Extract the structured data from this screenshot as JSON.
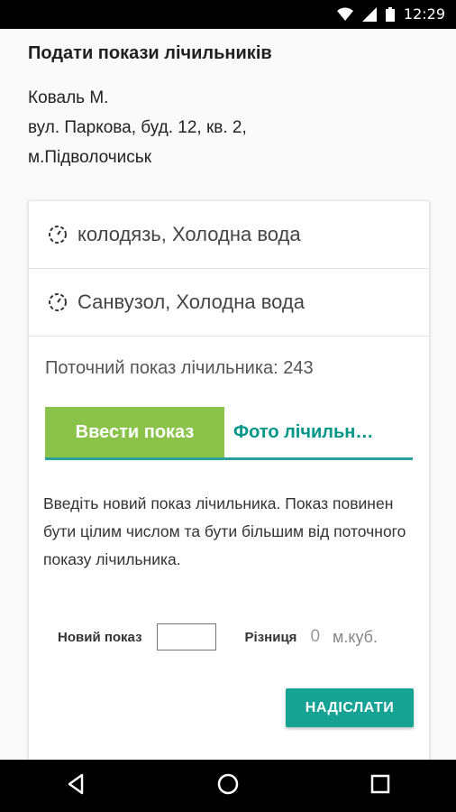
{
  "status_bar": {
    "time": "12:29",
    "icons": [
      "wifi-icon",
      "signal-icon",
      "battery-icon"
    ]
  },
  "header": {
    "title": "Подати покази лічильників"
  },
  "account": {
    "name": "Коваль М.",
    "street": "вул. Паркова, буд. 12, кв. 2,",
    "city": "м.Підволочиськ"
  },
  "meters": [
    {
      "label": "колодязь, Холодна вода",
      "icon": "gauge-icon"
    },
    {
      "label": "Санвузол, Холодна вода",
      "icon": "gauge-icon"
    }
  ],
  "reading": {
    "current_text": "Поточний показ лічильника: 243"
  },
  "tabs": [
    {
      "label": "Ввести показ",
      "active": true
    },
    {
      "label": "Фото лічильн…",
      "active": false
    }
  ],
  "instructions": "Введіть новий показ лічильника. Показ повинен бути цілим числом та бути більшим від поточного показу лічильника.",
  "form": {
    "new_label": "Новий показ",
    "new_value": "",
    "diff_label": "Різниця",
    "diff_value": "0",
    "unit": "м.куб."
  },
  "actions": {
    "send_label": "НАДІСЛАТИ"
  },
  "colors": {
    "accent": "#16a394",
    "active_tab": "#8bc34a"
  },
  "nav": [
    "back-icon",
    "home-icon",
    "recents-icon"
  ]
}
